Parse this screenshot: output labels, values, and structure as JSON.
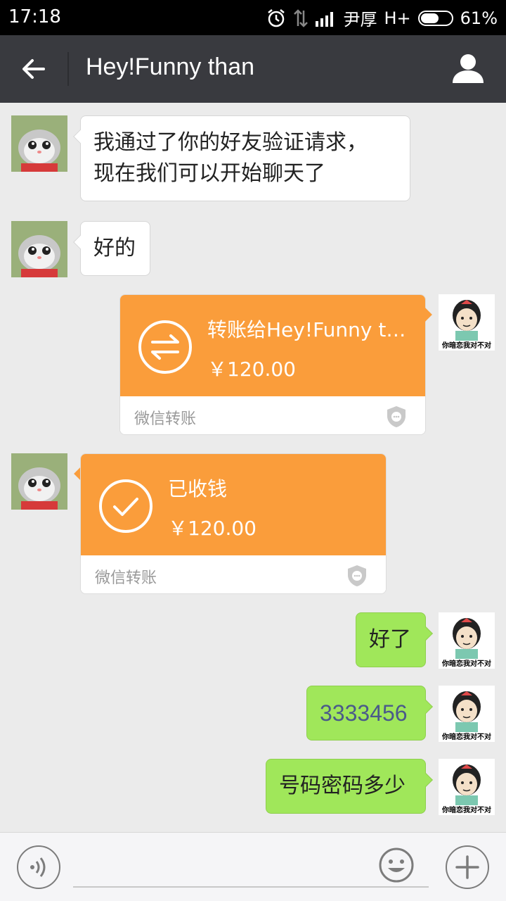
{
  "status_bar": {
    "time": "17:18",
    "carrier": "尹厚",
    "network": "H+",
    "battery": "61%",
    "battery_level": 0.61
  },
  "header": {
    "title": "Hey!Funny than"
  },
  "messages": [
    {
      "side": "left",
      "type": "text",
      "text": "我通过了你的好友验证请求，\n现在我们可以开始聊天了"
    },
    {
      "side": "left",
      "type": "text",
      "text": "好的"
    },
    {
      "side": "right",
      "type": "transfer",
      "title": "转账给Hey!Funny t…",
      "amount": "￥120.00",
      "footer": "微信转账"
    },
    {
      "side": "left",
      "type": "transfer",
      "title": "已收钱",
      "amount": "￥120.00",
      "footer": "微信转账"
    },
    {
      "side": "right",
      "type": "text",
      "text": "好了"
    },
    {
      "side": "right",
      "type": "text",
      "text": "3333456"
    },
    {
      "side": "right",
      "type": "text",
      "text": "号码密码多少"
    }
  ],
  "avatars": {
    "self_caption": "你暗恋我对不对"
  },
  "colors": {
    "header_bg": "#393a3f",
    "chat_bg": "#ebebeb",
    "bubble_green": "#a0e75a",
    "transfer_orange": "#fa9d3b"
  }
}
